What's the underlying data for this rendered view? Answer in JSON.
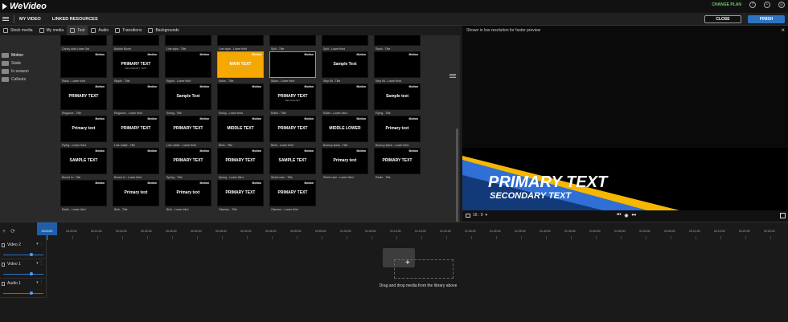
{
  "app": {
    "name": "WeVideo"
  },
  "topbar": {
    "change_plan": "CHANGE PLAN",
    "help_icon": "help-icon",
    "bell_icon": "bell-icon",
    "user_icon": "user-icon"
  },
  "menubar": {
    "my_video": "MY VIDEO",
    "linked_resources": "LINKED RESOURCES",
    "close_label": "CLOSE",
    "finish_label": "FINISH"
  },
  "library_tabs": [
    {
      "label": "Stock media",
      "icon": "star-icon"
    },
    {
      "label": "My media",
      "icon": "folder-icon"
    },
    {
      "label": "Text",
      "icon": "text-icon",
      "active": true
    },
    {
      "label": "Audio",
      "icon": "music-icon"
    },
    {
      "label": "Transitions",
      "icon": "transition-icon"
    },
    {
      "label": "Backgrounds",
      "icon": "background-icon"
    }
  ],
  "categories": [
    "Motion",
    "Static",
    "In season",
    "Callouts"
  ],
  "text_items": [
    {
      "caption": "Candy dots Lower 3rd",
      "badge": "",
      "t1": "",
      "t2": ""
    },
    {
      "caption": "Bubble Boom",
      "badge": "",
      "t1": "",
      "t2": ""
    },
    {
      "caption": "Line wipe - Title",
      "badge": "",
      "t1": "",
      "t2": ""
    },
    {
      "caption": "Line wipe - Lower third",
      "badge": "",
      "t1": "",
      "t2": ""
    },
    {
      "caption": "Split - Title",
      "badge": "",
      "t1": "",
      "t2": ""
    },
    {
      "caption": "Split - Lower third",
      "badge": "",
      "t1": "",
      "t2": ""
    },
    {
      "caption": "Stack - Title",
      "badge": "",
      "t1": "YOUR",
      "t2": ""
    },
    {
      "caption": "Stack - Lower third",
      "badge": "Motion",
      "t1": "",
      "t2": ""
    },
    {
      "caption": "Ripple - Title",
      "badge": "Motion",
      "t1": "PRIMARY TEXT",
      "t2": "SECONDARY TEXT"
    },
    {
      "caption": "Ripple - Lower third",
      "badge": "Motion",
      "t1": "",
      "t2": ""
    },
    {
      "caption": "Stoke - Title",
      "badge": "Motion",
      "t1": "MAIN TEXT",
      "t2": "BOTTOM TEXT"
    },
    {
      "caption": "Stoke - Lower third",
      "badge": "Motion",
      "t1": "",
      "t2": ""
    },
    {
      "caption": "Step tilt - Title",
      "badge": "Motion",
      "t1": "Sample Text",
      "t2": ""
    },
    {
      "caption": "Step tilt - Lower third",
      "badge": "Motion",
      "t1": "",
      "t2": ""
    },
    {
      "caption": "Elegance - Title",
      "badge": "Motion",
      "t1": "PRIMARY TEXT",
      "t2": ""
    },
    {
      "caption": "Elegance - Lower third",
      "badge": "Motion",
      "t1": "",
      "t2": ""
    },
    {
      "caption": "Swing - Title",
      "badge": "Motion",
      "t1": "Sample Text",
      "t2": ""
    },
    {
      "caption": "Swing - Lower third",
      "badge": "Motion",
      "t1": "",
      "t2": ""
    },
    {
      "caption": "Roller - Title",
      "badge": "Motion",
      "t1": "PRIMARY TEXT",
      "t2": "SECONDARY"
    },
    {
      "caption": "Roller - Lower third",
      "badge": "Motion",
      "t1": "",
      "t2": ""
    },
    {
      "caption": "Flying - Title",
      "badge": "Motion",
      "t1": "Sample text",
      "t2": ""
    },
    {
      "caption": "Flying - Lower third",
      "badge": "Motion",
      "t1": "Primary text",
      "t2": ""
    },
    {
      "caption": "Line rotate - Title",
      "badge": "Motion",
      "t1": "PRIMARY TEXT",
      "t2": ""
    },
    {
      "caption": "Line rotate - Lower third",
      "badge": "Motion",
      "t1": "PRIMARY TEXT",
      "t2": ""
    },
    {
      "caption": "Blink - Title",
      "badge": "Motion",
      "t1": "MIDDLE TEXT",
      "t2": ""
    },
    {
      "caption": "Blink - Lower third",
      "badge": "Motion",
      "t1": "PRIMARY TEXT",
      "t2": ""
    },
    {
      "caption": "Bouncy stack - Title",
      "badge": "Motion",
      "t1": "MIDDLE LOWER",
      "t2": ""
    },
    {
      "caption": "Bouncy stack - Lower third",
      "badge": "Motion",
      "t1": "Primary text",
      "t2": ""
    },
    {
      "caption": "Boxed In - Title",
      "badge": "Motion",
      "t1": "SAMPLE TEXT",
      "t2": ""
    },
    {
      "caption": "Boxed In - Lower third",
      "badge": "Motion",
      "t1": "",
      "t2": ""
    },
    {
      "caption": "Spring - Title",
      "badge": "Motion",
      "t1": "PRIMARY TEXT",
      "t2": ""
    },
    {
      "caption": "Spring - Lower third",
      "badge": "Motion",
      "t1": "PRIMARY TEXT",
      "t2": ""
    },
    {
      "caption": "Street race - Title",
      "badge": "Motion",
      "t1": "SAMPLE TEXT",
      "t2": ""
    },
    {
      "caption": "Street race - Lower third",
      "badge": "Motion",
      "t1": "Primary text",
      "t2": ""
    },
    {
      "caption": "Radio - Title",
      "badge": "Motion",
      "t1": "PRIMARY TEXT",
      "t2": ""
    },
    {
      "caption": "Radio - Lower third",
      "badge": "Motion",
      "t1": "",
      "t2": ""
    },
    {
      "caption": "Blob - Title",
      "badge": "Motion",
      "t1": "Primary text",
      "t2": ""
    },
    {
      "caption": "Blob - Lower third",
      "badge": "Motion",
      "t1": "Primary text",
      "t2": ""
    },
    {
      "caption": "Glamour - Title",
      "badge": "Motion",
      "t1": "PRIMARY TEXT",
      "t2": ""
    },
    {
      "caption": "Glamour - Lower third",
      "badge": "Motion",
      "t1": "PRIMARY TEXT",
      "t2": ""
    }
  ],
  "preview": {
    "note": "Shown in low resolution for faster preview",
    "primary_text": "PRIMARY TEXT",
    "secondary_text": "SECONDARY TEXT",
    "aspect": "16 : 9",
    "accent_yellow": "#f5b700",
    "accent_blue": "#2f6fd6"
  },
  "timeline": {
    "current_time": "00:00:00",
    "ticks": [
      "00:00:00",
      "00:10:00",
      "00:15:00",
      "00:20:00",
      "00:25:00",
      "00:30:00",
      "00:35:00",
      "00:40:00",
      "00:45:00",
      "00:50:00",
      "00:55:00",
      "01:00:00",
      "01:05:00",
      "01:10:00",
      "01:15:00",
      "01:20:00",
      "01:25:00",
      "01:30:00",
      "01:35:00",
      "01:40:00",
      "01:45:00",
      "01:50:00",
      "01:55:00",
      "02:00:00",
      "02:05:00",
      "02:10:00",
      "02:15:00",
      "02:20:00",
      "02:25:00",
      "02:30:00"
    ],
    "tracks": [
      "Video 2",
      "Video 1",
      "Audio 1"
    ],
    "drop_text": "Drag and drop media from the library above"
  }
}
